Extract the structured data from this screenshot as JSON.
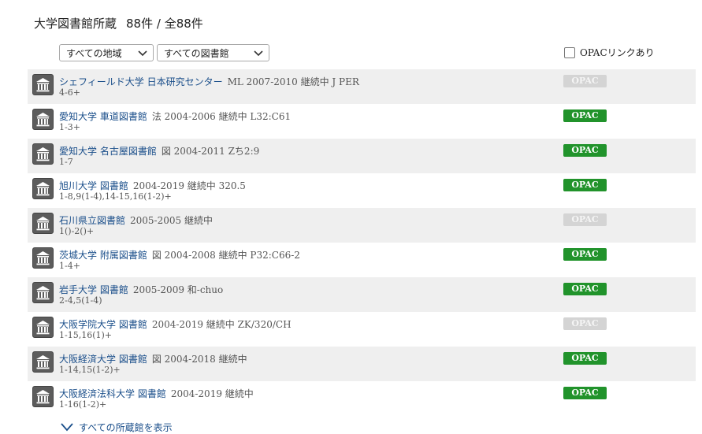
{
  "header": {
    "title": "大学図書館所蔵",
    "count": "88件 / 全88件"
  },
  "filters": {
    "region_selected": "すべての地域",
    "library_selected": "すべての図書館",
    "opac_checkbox_label": "OPACリンクあり"
  },
  "opac_label": "OPAC",
  "holdings": [
    {
      "library": "シェフィールド大学 日本研究センター",
      "meta": "ML  2007-2010  継続中  J PER",
      "volumes": "4-6+",
      "opac": false
    },
    {
      "library": "愛知大学 車道図書館",
      "meta": "法  2004-2006  継続中  L32:C61",
      "volumes": "1-3+",
      "opac": true
    },
    {
      "library": "愛知大学 名古屋図書館",
      "meta": "図  2004-2011  Zち2:9",
      "volumes": "1-7",
      "opac": true
    },
    {
      "library": "旭川大学 図書館",
      "meta": "2004-2019  継続中  320.5",
      "volumes": "1-8,9(1-4),14-15,16(1-2)+",
      "opac": true
    },
    {
      "library": "石川県立図書館",
      "meta": "2005-2005  継続中",
      "volumes": "1()-2()+",
      "opac": false
    },
    {
      "library": "茨城大学 附属図書館",
      "meta": "図  2004-2008  継続中  P32:C66-2",
      "volumes": "1-4+",
      "opac": true
    },
    {
      "library": "岩手大学 図書館",
      "meta": "2005-2009  和-chuo",
      "volumes": "2-4,5(1-4)",
      "opac": true
    },
    {
      "library": "大阪学院大学 図書館",
      "meta": "2004-2019  継続中  ZK/320/CH",
      "volumes": "1-15,16(1)+",
      "opac": false
    },
    {
      "library": "大阪経済大学 図書館",
      "meta": "図  2004-2018  継続中",
      "volumes": "1-14,15(1-2)+",
      "opac": true
    },
    {
      "library": "大阪経済法科大学 図書館",
      "meta": "2004-2019  継続中",
      "volumes": "1-16(1-2)+",
      "opac": true
    }
  ],
  "footer": {
    "show_all_label": "すべての所蔵館を表示"
  }
}
